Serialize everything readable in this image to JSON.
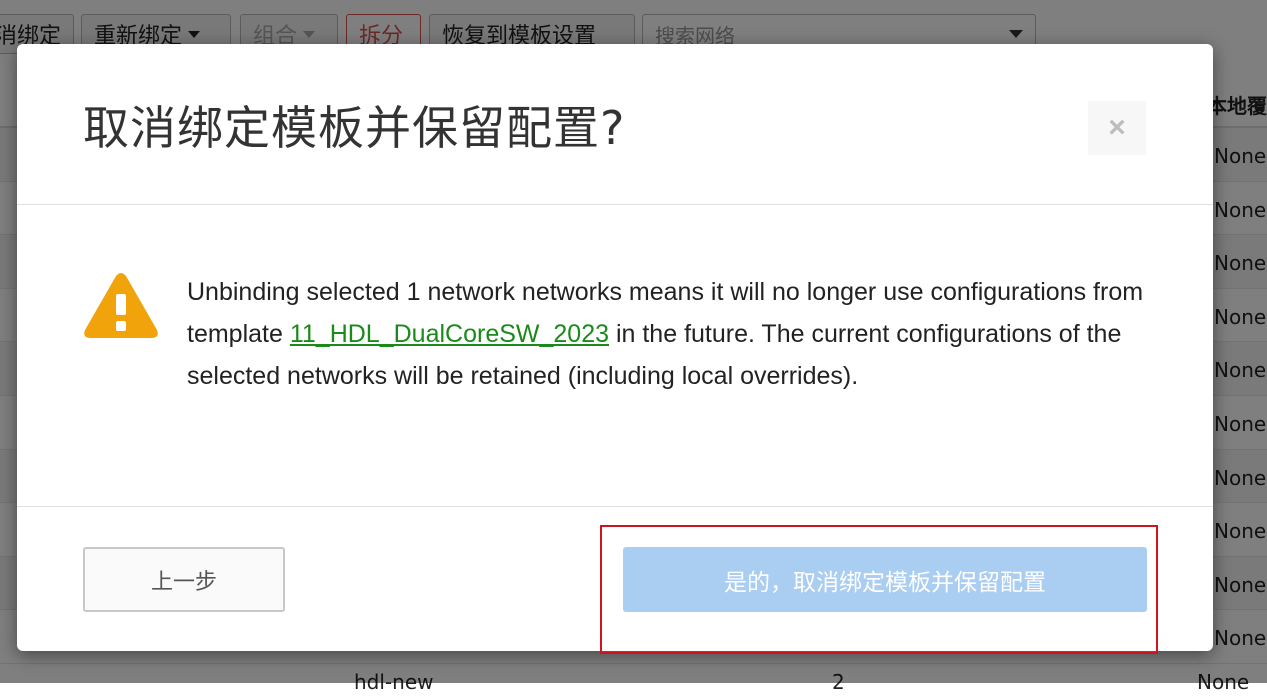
{
  "background": {
    "toolbar": {
      "unbind_label": "取消绑定",
      "rebind_label": "重新绑定",
      "combine_label": "组合",
      "split_label": "拆分",
      "restore_label": "恢复到模板设置",
      "search_placeholder": "搜索网络"
    },
    "table": {
      "visible_header": "本地覆盖",
      "rows": [
        "None",
        "None",
        "None",
        "None",
        "None",
        "None",
        "None",
        "None",
        "None",
        "None"
      ],
      "last_row": {
        "name": "hdl-new",
        "count": "2",
        "override": "None"
      }
    }
  },
  "modal": {
    "title": "取消绑定模板并保留配置?",
    "close_symbol": "×",
    "warning_icon": "warning-triangle-icon",
    "message_before": "Unbinding selected 1 network networks means it will no longer use configurations from template ",
    "template_link": "11_HDL_DualCoreSW_2023",
    "message_after": " in the future. The current configurations of the selected networks will be retained (including local overrides).",
    "back_label": "上一步",
    "confirm_label": "是的，取消绑定模板并保留配置"
  },
  "colors": {
    "warning": "#f0a30a",
    "link": "#1a8a1a",
    "confirm_button": "#aacdf2",
    "highlight": "#d0131e"
  }
}
